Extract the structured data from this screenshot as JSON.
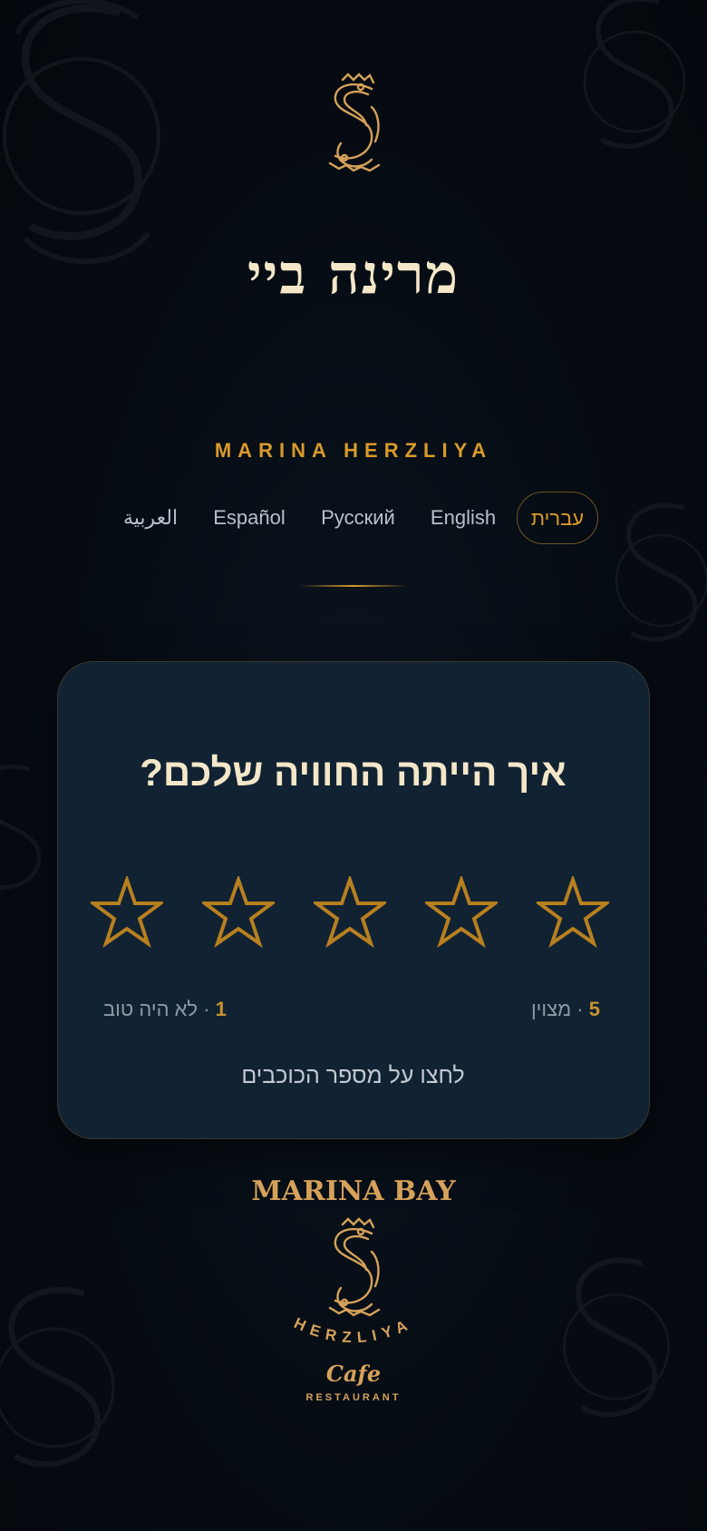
{
  "brand": {
    "title_hebrew": "מרינה ביי",
    "subtitle": "MARINA HERZLIYA"
  },
  "languages": [
    {
      "label": "עברית",
      "active": true
    },
    {
      "label": "English",
      "active": false
    },
    {
      "label": "Русский",
      "active": false
    },
    {
      "label": "Español",
      "active": false
    },
    {
      "label": "العربية",
      "active": false
    }
  ],
  "rating_card": {
    "question": "איך הייתה החוויה שלכם?",
    "stars": 5,
    "high_label": {
      "num": "5",
      "text": " · מצוין"
    },
    "low_label": {
      "num": "1",
      "text": " · לא היה טוב"
    },
    "hint": "לחצו על מספר הכוכבים"
  },
  "footer": {
    "brand": "MARINA BAY",
    "location": "HERZLIYA",
    "cafe": "Cafe",
    "restaurant": "RESTAURANT"
  },
  "colors": {
    "background": "#060c13",
    "card": "#112233",
    "gold": "#d99a2b",
    "cream": "#f4e7c8"
  },
  "icons": {
    "logo": "ornate-s-monogram-icon",
    "star": "star-outline-icon"
  }
}
